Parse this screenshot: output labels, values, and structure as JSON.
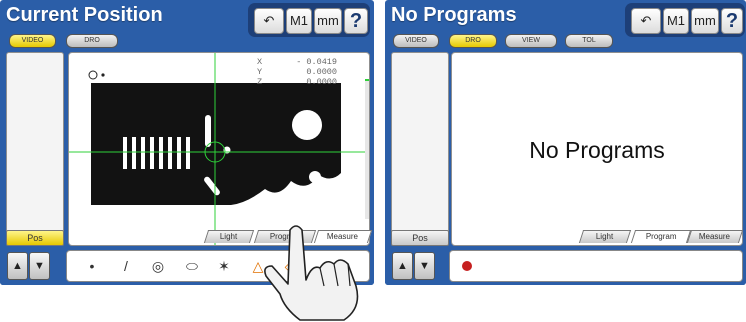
{
  "left": {
    "title": "Current Position",
    "mode_buttons": [
      {
        "label": "VIDEO",
        "active": true
      },
      {
        "label": "DRO",
        "active": false
      }
    ],
    "top_buttons": {
      "undo_icon": "undo-icon",
      "m1": "M1",
      "units": "mm",
      "help": "?"
    },
    "readout": {
      "x_label": "X",
      "x_value": "- 0.0419",
      "y_label": "Y",
      "y_value": "0.0000",
      "z_label": "Z",
      "z_value": "0.0000"
    },
    "pos_label": "Pos",
    "tabs": [
      "Light",
      "Program",
      "Measure"
    ],
    "active_tab": "Measure",
    "tools": [
      "point-tool-icon",
      "line-tool-icon",
      "circle-tool-icon",
      "slot-tool-icon",
      "magic-wand-icon",
      "triangle-tool-icon",
      "shape-tool-icon",
      "blank-tool-icon"
    ]
  },
  "right": {
    "title": "No Programs",
    "mode_buttons": [
      {
        "label": "VIDEO",
        "active": false
      },
      {
        "label": "DRO",
        "active": true
      },
      {
        "label": "VIEW",
        "active": false
      },
      {
        "label": "TOL",
        "active": false
      }
    ],
    "top_buttons": {
      "undo_icon": "undo-icon",
      "m1": "M1",
      "units": "mm",
      "help": "?"
    },
    "message": "No Programs",
    "pos_label": "Pos",
    "tabs": [
      "Light",
      "Program",
      "Measure"
    ],
    "active_tab": "Program",
    "record_icon": "record-icon"
  },
  "colors": {
    "screen_bg": "#2b5ea8",
    "active_pill": "#f0d400",
    "crosshair": "#2fd23a",
    "record": "#c62020"
  }
}
